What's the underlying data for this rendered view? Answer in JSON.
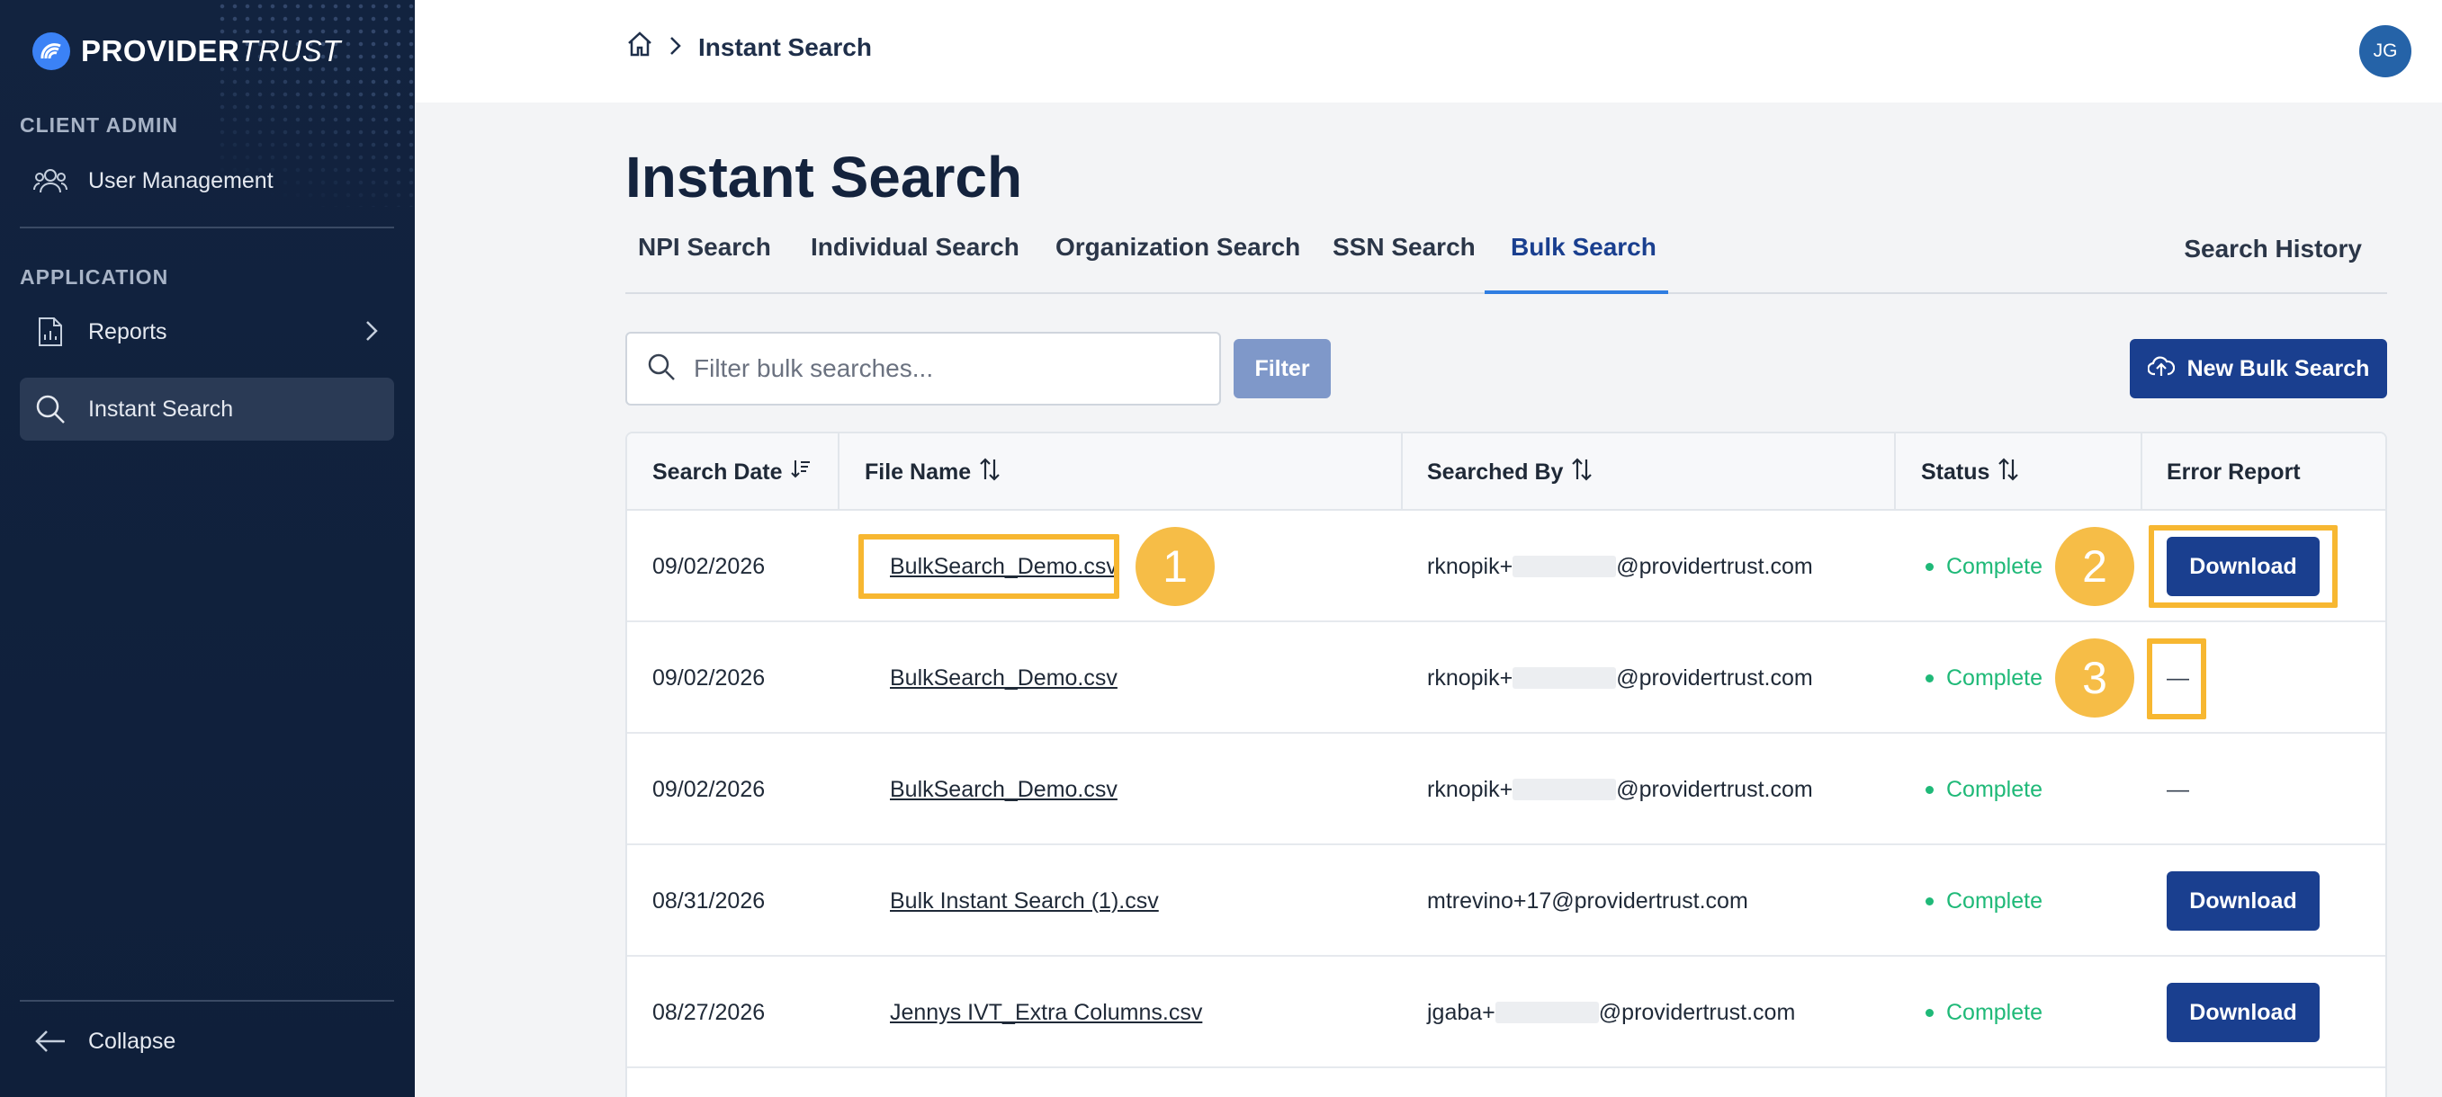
{
  "brand": {
    "name_strong": "PROVIDER",
    "name_light": "TRUST"
  },
  "sidebar": {
    "sections": [
      {
        "label": "CLIENT ADMIN"
      },
      {
        "label": "APPLICATION"
      }
    ],
    "items": [
      {
        "label": "User Management",
        "icon": "users-icon"
      },
      {
        "label": "Reports",
        "icon": "report-icon"
      },
      {
        "label": "Instant Search",
        "icon": "search-icon",
        "active": true
      }
    ],
    "collapse_label": "Collapse"
  },
  "header": {
    "breadcrumb": {
      "current": "Instant Search"
    },
    "avatar_initials": "JG"
  },
  "main": {
    "title": "Instant Search",
    "tabs": [
      {
        "label": "NPI Search"
      },
      {
        "label": "Individual Search"
      },
      {
        "label": "Organization Search"
      },
      {
        "label": "SSN Search"
      },
      {
        "label": "Bulk Search",
        "active": true
      }
    ],
    "history_label": "Search History",
    "filter": {
      "placeholder": "Filter bulk searches...",
      "button": "Filter"
    },
    "new_button": "New Bulk Search"
  },
  "table": {
    "columns": [
      "Search Date",
      "File Name",
      "Searched By",
      "Status",
      "Error Report"
    ],
    "rows": [
      {
        "date": "09/02/2026",
        "file": "BulkSearch_Demo.csv",
        "by_prefix": "rknopik+",
        "by_suffix": "@providertrust.com",
        "redacted": true,
        "status": "Complete",
        "error": "Download"
      },
      {
        "date": "09/02/2026",
        "file": "BulkSearch_Demo.csv",
        "by_prefix": "rknopik+",
        "by_suffix": "@providertrust.com",
        "redacted": true,
        "status": "Complete",
        "error": "—"
      },
      {
        "date": "09/02/2026",
        "file": "BulkSearch_Demo.csv",
        "by_prefix": "rknopik+",
        "by_suffix": "@providertrust.com",
        "redacted": true,
        "status": "Complete",
        "error": "—"
      },
      {
        "date": "08/31/2026",
        "file": "Bulk Instant Search (1).csv",
        "by_prefix": "mtrevino+17@providertrust.com",
        "by_suffix": "",
        "redacted": false,
        "status": "Complete",
        "error": "Download"
      },
      {
        "date": "08/27/2026",
        "file": "Jennys IVT_Extra Columns.csv",
        "by_prefix": "jgaba+",
        "by_suffix": "@providertrust.com",
        "redacted": true,
        "status": "Complete",
        "error": "Download"
      }
    ]
  },
  "annotations": [
    "1",
    "2",
    "3"
  ],
  "colors": {
    "accent": "#1a3f8f",
    "success": "#1fb978",
    "highlight": "#f7b731",
    "sidebar": "#12233f"
  }
}
